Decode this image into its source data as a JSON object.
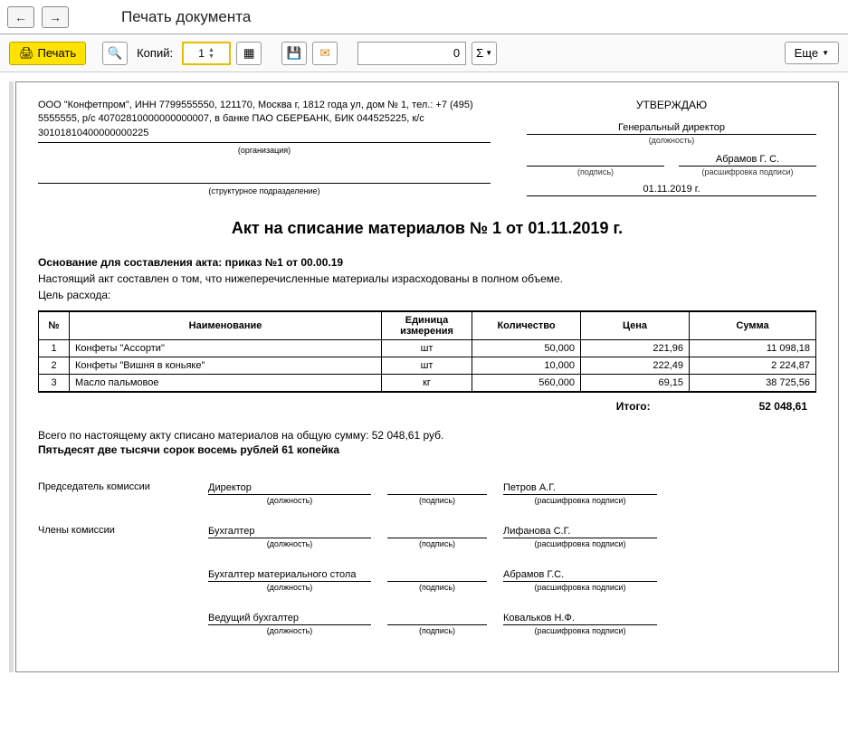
{
  "top": {
    "back": "←",
    "fwd": "→",
    "title": "Печать документа"
  },
  "toolbar": {
    "print": "Печать",
    "preview_icon": "🔍",
    "copies_label": "Копий:",
    "copies_value": "1",
    "table_icon": "▦",
    "save_icon": "💾",
    "mail_icon": "✉",
    "num_value": "0",
    "sum_icon": "Σ",
    "more": "Еще"
  },
  "org": {
    "lines": "ООО \"Конфетпром\", ИНН 7799555550, 121170, Москва г, 1812 года ул, дом № 1, тел.: +7 (495) 5555555, р/с 40702810000000000007, в банке ПАО СБЕРБАНК, БИК 044525225, к/с 30101810400000000225",
    "org_hint": "(организация)",
    "dept_hint": "(структурное подразделение)"
  },
  "approve": {
    "title": "УТВЕРЖДАЮ",
    "position": "Генеральный директор",
    "position_hint": "(должность)",
    "sig_hint": "(подпись)",
    "name": "Абрамов Г. С.",
    "name_hint": "(расшифровка подписи)",
    "date": "01.11.2019 г."
  },
  "doc_title": "Акт на списание материалов № 1 от 01.11.2019 г.",
  "basis_label": "Основание для составления акта: приказ №1 от 00.00.19",
  "note1": "Настоящий акт составлен о том, что нижеперечисленные материалы израсходованы в полном объеме.",
  "note2": "Цель расхода:",
  "table": {
    "headers": {
      "num": "№",
      "name": "Наименование",
      "unit": "Единица измерения",
      "qty": "Количество",
      "price": "Цена",
      "sum": "Сумма"
    },
    "rows": [
      {
        "num": "1",
        "name": "Конфеты \"Ассорти\"",
        "unit": "шт",
        "qty": "50,000",
        "price": "221,96",
        "sum": "11 098,18"
      },
      {
        "num": "2",
        "name": "Конфеты \"Вишня в коньяке\"",
        "unit": "шт",
        "qty": "10,000",
        "price": "222,49",
        "sum": "2 224,87"
      },
      {
        "num": "3",
        "name": "Масло пальмовое",
        "unit": "кг",
        "qty": "560,000",
        "price": "69,15",
        "sum": "38 725,56"
      }
    ],
    "total_label": "Итого:",
    "total_sum": "52 048,61"
  },
  "total_line": "Всего по настоящему акту списано материалов на общую сумму: 52 048,61 руб.",
  "words": "Пятьдесят две тысячи сорок восемь рублей 61 копейка",
  "commission": {
    "chair_label": "Председатель комиссии",
    "members_label": "Члены комиссии",
    "pos_hint": "(должность)",
    "sig_hint": "(подпись)",
    "dec_hint": "(расшифровка подписи)",
    "rows": [
      {
        "pos": "Директор",
        "name": "Петров А.Г."
      },
      {
        "pos": "Бухгалтер",
        "name": "Лифанова С.Г."
      },
      {
        "pos": "Бухгалтер материального стола",
        "name": "Абрамов Г.С."
      },
      {
        "pos": "Ведущий бухгалтер",
        "name": "Ковальков Н.Ф."
      }
    ]
  }
}
